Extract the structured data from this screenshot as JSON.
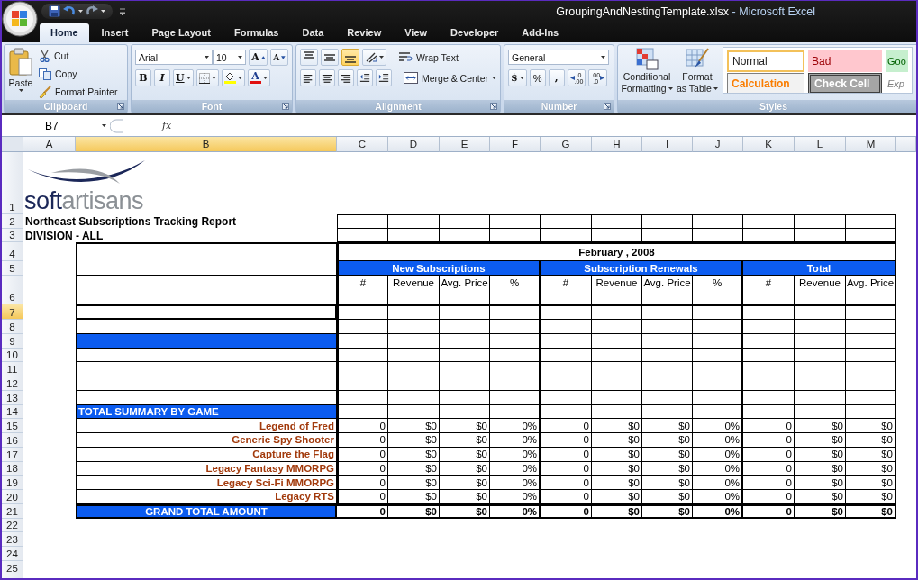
{
  "window": {
    "file_name": "GroupingAndNestingTemplate.xlsx",
    "app_name": "- Microsoft Excel"
  },
  "tabs": [
    {
      "label": "Home",
      "selected": true
    },
    {
      "label": "Insert",
      "selected": false
    },
    {
      "label": "Page Layout",
      "selected": false
    },
    {
      "label": "Formulas",
      "selected": false
    },
    {
      "label": "Data",
      "selected": false
    },
    {
      "label": "Review",
      "selected": false
    },
    {
      "label": "View",
      "selected": false
    },
    {
      "label": "Developer",
      "selected": false
    },
    {
      "label": "Add-Ins",
      "selected": false
    }
  ],
  "ribbon": {
    "clipboard": {
      "label": "Clipboard",
      "paste": "Paste",
      "cut": "Cut",
      "copy": "Copy",
      "format_painter": "Format Painter"
    },
    "font": {
      "label": "Font",
      "font_name": "Arial",
      "font_size": "10",
      "grow": "A",
      "shrink": "A",
      "bold": "B",
      "italic": "I",
      "underline": "U",
      "font_color": "A"
    },
    "alignment": {
      "label": "Alignment",
      "vertical": [
        {
          "kind": "top",
          "selected": false
        },
        {
          "kind": "middle",
          "selected": false
        },
        {
          "kind": "bottom",
          "selected": true
        }
      ],
      "horizontal": [
        {
          "kind": "left",
          "selected": false
        },
        {
          "kind": "center",
          "selected": false
        },
        {
          "kind": "right",
          "selected": false
        }
      ],
      "wrap_text": "Wrap Text",
      "merge_center": "Merge & Center"
    },
    "number": {
      "label": "Number",
      "format": "General",
      "currency": "$",
      "percent": "%",
      "comma": ",",
      "increase_decimal": {
        "top": ".0",
        "bottom": ".00"
      },
      "decrease_decimal": {
        "top": ".00",
        "bottom": ".0"
      }
    },
    "styles": {
      "label": "Styles",
      "conditional": [
        "Conditional",
        "Formatting"
      ],
      "format_table": [
        "Format",
        "as Table"
      ],
      "gallery": [
        {
          "kind": "normal",
          "label": "Normal"
        },
        {
          "kind": "bad",
          "label": "Bad"
        },
        {
          "kind": "good",
          "label": "Goo"
        },
        {
          "kind": "calculation",
          "label": "Calculation"
        },
        {
          "kind": "check",
          "label": "Check Cell"
        },
        {
          "kind": "explanatory",
          "label": "Exp"
        }
      ]
    }
  },
  "formula_bar": {
    "name_box": "B7",
    "fx": "fx"
  },
  "sheet": {
    "columns": [
      {
        "label": "A",
        "selected": false
      },
      {
        "label": "B",
        "selected": true
      },
      {
        "label": "C",
        "selected": false
      },
      {
        "label": "D",
        "selected": false
      },
      {
        "label": "E",
        "selected": false
      },
      {
        "label": "F",
        "selected": false
      },
      {
        "label": "G",
        "selected": false
      },
      {
        "label": "H",
        "selected": false
      },
      {
        "label": "I",
        "selected": false
      },
      {
        "label": "J",
        "selected": false
      },
      {
        "label": "K",
        "selected": false
      },
      {
        "label": "L",
        "selected": false
      },
      {
        "label": "M",
        "selected": false
      }
    ],
    "rows": [
      {
        "label": "1",
        "selected": false
      },
      {
        "label": "2",
        "selected": false
      },
      {
        "label": "3",
        "selected": false
      },
      {
        "label": "4",
        "selected": false
      },
      {
        "label": "5",
        "selected": false
      },
      {
        "label": "6",
        "selected": false
      },
      {
        "label": "7",
        "selected": true
      },
      {
        "label": "8",
        "selected": false
      },
      {
        "label": "9",
        "selected": false
      },
      {
        "label": "10",
        "selected": false
      },
      {
        "label": "11",
        "selected": false
      },
      {
        "label": "12",
        "selected": false
      },
      {
        "label": "13",
        "selected": false
      },
      {
        "label": "14",
        "selected": false
      },
      {
        "label": "15",
        "selected": false
      },
      {
        "label": "16",
        "selected": false
      },
      {
        "label": "17",
        "selected": false
      },
      {
        "label": "18",
        "selected": false
      },
      {
        "label": "19",
        "selected": false
      },
      {
        "label": "20",
        "selected": false
      },
      {
        "label": "21",
        "selected": false
      },
      {
        "label": "22",
        "selected": false
      },
      {
        "label": "23",
        "selected": false
      },
      {
        "label": "24",
        "selected": false
      },
      {
        "label": "25",
        "selected": false
      }
    ],
    "logo": {
      "dark": "soft",
      "light": "artisans"
    },
    "title": "Northeast Subscriptions Tracking Report",
    "division": "DIVISION - ALL",
    "report": {
      "period": "February , 2008",
      "groups": [
        {
          "name": "New Subscriptions",
          "columns": [
            "#",
            "Revenue",
            "Avg. Price",
            "%"
          ]
        },
        {
          "name": "Subscription Renewals",
          "columns": [
            "#",
            "Revenue",
            "Avg. Price",
            "%"
          ]
        },
        {
          "name": "Total",
          "columns": [
            "#",
            "Revenue",
            "Avg. Price"
          ]
        }
      ],
      "summary_heading": "TOTAL SUMMARY BY GAME",
      "games": [
        {
          "name": "Legend of Fred",
          "values": [
            "0",
            "$0",
            "$0",
            "0%",
            "0",
            "$0",
            "$0",
            "0%",
            "0",
            "$0",
            "$0"
          ]
        },
        {
          "name": "Generic Spy Shooter",
          "values": [
            "0",
            "$0",
            "$0",
            "0%",
            "0",
            "$0",
            "$0",
            "0%",
            "0",
            "$0",
            "$0"
          ]
        },
        {
          "name": "Capture the Flag",
          "values": [
            "0",
            "$0",
            "$0",
            "0%",
            "0",
            "$0",
            "$0",
            "0%",
            "0",
            "$0",
            "$0"
          ]
        },
        {
          "name": "Legacy Fantasy MMORPG",
          "values": [
            "0",
            "$0",
            "$0",
            "0%",
            "0",
            "$0",
            "$0",
            "0%",
            "0",
            "$0",
            "$0"
          ]
        },
        {
          "name": "Legacy Sci-Fi MMORPG",
          "values": [
            "0",
            "$0",
            "$0",
            "0%",
            "0",
            "$0",
            "$0",
            "0%",
            "0",
            "$0",
            "$0"
          ]
        },
        {
          "name": "Legacy RTS",
          "values": [
            "0",
            "$0",
            "$0",
            "0%",
            "0",
            "$0",
            "$0",
            "0%",
            "0",
            "$0",
            "$0"
          ]
        }
      ],
      "grand_total": {
        "label": "GRAND TOTAL AMOUNT",
        "values": [
          "0",
          "$0",
          "$0",
          "0%",
          "0",
          "$0",
          "$0",
          "0%",
          "0",
          "$0",
          "$0"
        ]
      }
    }
  }
}
